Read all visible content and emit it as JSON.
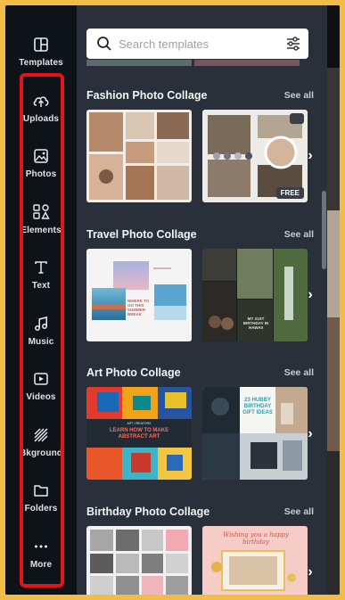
{
  "sidebar": {
    "items": [
      {
        "label": "Templates",
        "icon": "layout-icon"
      },
      {
        "label": "Uploads",
        "icon": "cloud-upload-icon"
      },
      {
        "label": "Photos",
        "icon": "image-icon"
      },
      {
        "label": "Elements",
        "icon": "shapes-icon"
      },
      {
        "label": "Text",
        "icon": "text-icon"
      },
      {
        "label": "Music",
        "icon": "music-note-icon"
      },
      {
        "label": "Videos",
        "icon": "video-icon"
      },
      {
        "label": "Bkground",
        "icon": "background-hatch-icon"
      },
      {
        "label": "Folders",
        "icon": "folder-icon"
      },
      {
        "label": "More",
        "icon": "more-dots-icon"
      }
    ]
  },
  "search": {
    "placeholder": "Search templates"
  },
  "sections": [
    {
      "title": "Fashion Photo Collage",
      "see_all": "See all",
      "badge": "FREE"
    },
    {
      "title": "Travel Photo Collage",
      "see_all": "See all",
      "thumb1_text": "WHERE TO GO THIS SUMMER BREAK",
      "thumb2_text": "MY 21ST BIRTHDAY IN HAWAII"
    },
    {
      "title": "Art Photo Collage",
      "see_all": "See all",
      "thumb1_text": "LEARN HOW TO MAKE ABSTRACT ART",
      "thumb1_small": "ART CREATORS",
      "thumb2_text": "23 HUBBY BIRTHDAY GIFT IDEAS"
    },
    {
      "title": "Birthday Photo Collage",
      "see_all": "See all",
      "thumb2_text": "Wishing you a happy birthday"
    }
  ],
  "colors": {
    "rail_bg": "#0e1318",
    "panel_bg": "#293039",
    "highlight": "#e5141b",
    "outer_bg": "#f2bd44"
  }
}
